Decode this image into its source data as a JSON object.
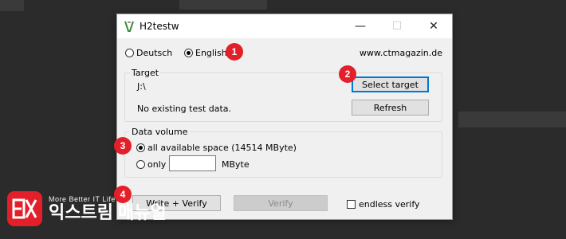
{
  "window": {
    "title": "H2testw",
    "controls": {
      "minimize": "—",
      "maximize": "☐",
      "close": "✕"
    }
  },
  "language": {
    "options": [
      {
        "label": "Deutsch",
        "selected": false
      },
      {
        "label": "English",
        "selected": true
      }
    ]
  },
  "url": "www.ctmagazin.de",
  "target": {
    "legend": "Target",
    "path": "J:\\",
    "status": "No existing test data.",
    "select_button": "Select target",
    "refresh_button": "Refresh"
  },
  "data_volume": {
    "legend": "Data volume",
    "all_label": "all available space (14514 MByte)",
    "only_label": "only",
    "only_value": "",
    "unit": "MByte"
  },
  "actions": {
    "write_verify": "Write + Verify",
    "verify": "Verify",
    "endless_verify": "endless verify"
  },
  "badges": [
    "1",
    "2",
    "3",
    "4"
  ],
  "logo": {
    "tagline": "More Better IT Life",
    "name": "익스트림 매뉴얼"
  },
  "colors": {
    "badge": "#e3202a",
    "focus": "#0078d7",
    "background": "#2b2b2b"
  }
}
